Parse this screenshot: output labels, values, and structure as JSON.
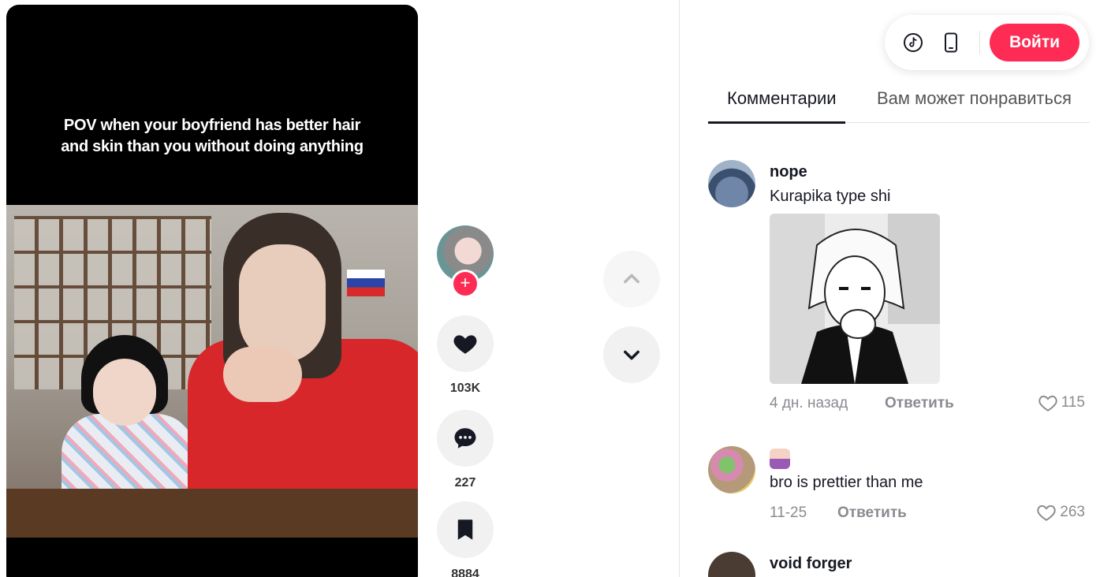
{
  "video": {
    "caption_line1": "POV when your boyfriend has better hair",
    "caption_line2": "and skin than you without doing anything"
  },
  "actions": {
    "follow_label": "+",
    "likes": "103K",
    "comments": "227",
    "saves": "8884"
  },
  "header": {
    "login_label": "Войти"
  },
  "tabs": [
    {
      "label": "Комментарии"
    },
    {
      "label": "Вам может понравиться"
    }
  ],
  "comments": [
    {
      "username": "nope",
      "text": "Kurapika type shi",
      "date": "4 дн. назад",
      "reply_label": "Ответить",
      "likes": "115"
    },
    {
      "username": "",
      "text": "bro is prettier than me",
      "date": "11-25",
      "reply_label": "Ответить",
      "likes": "263"
    },
    {
      "username": "void forger"
    }
  ],
  "colors": {
    "accent": "#fe2c55",
    "text": "#161823",
    "muted": "#8a8b91"
  }
}
